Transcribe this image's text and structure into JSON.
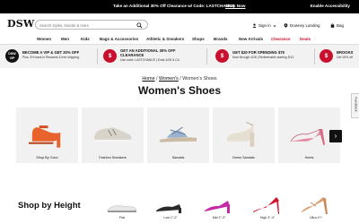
{
  "promo_bar": {
    "text": "Take an Additional 30% Off Clearance w/ Code: LASTCHANCE",
    "link": "Shop Now",
    "accessibility": "Enable Accessibility"
  },
  "header": {
    "logo": "DSW",
    "search_placeholder": "Search styles, brands & more",
    "signin": "Sign in",
    "store": "Downey Landing",
    "bag": "Bag"
  },
  "nav": {
    "items": [
      "Women",
      "Men",
      "Kids",
      "Bags & Accessories",
      "Athletic & Sneakers",
      "Shops",
      "Brands",
      "New Arrivals",
      "Clearance",
      "Deals"
    ]
  },
  "promos": [
    {
      "badge": "DSW VIP",
      "title": "BECOME A VIP & GET 20% OFF",
      "sub": "Plus, 5% back in Rewards & free shipping."
    },
    {
      "badge": "$",
      "title": "GET AN ADDITIONAL 30% OFF CLEARANCE",
      "sub": "Use code: LASTCHANCE | Ends 4/28 & CA"
    },
    {
      "badge": "$",
      "title": "GET $20 FOR SPENDING $75",
      "sub": "Now through 4/28 | Redeemable starting 5/12"
    },
    {
      "badge": "$",
      "title": "BROOKS",
      "sub": "Get 15% off"
    }
  ],
  "breadcrumb": {
    "home": "Home",
    "sep": "/",
    "women": "Women's",
    "current": "Women's Shoes"
  },
  "page_title": "Women's Shoes",
  "categories": [
    {
      "label": "Shop By Color",
      "color": "#e8622c"
    },
    {
      "label": "Fashion Sneakers",
      "color": "#d8d4cc"
    },
    {
      "label": "Sandals",
      "color": "#9cb3cf"
    },
    {
      "label": "Dress Sandals",
      "color": "#e6e0d2"
    },
    {
      "label": "Heels",
      "color": "#e58aa3"
    }
  ],
  "next_arrow": "›",
  "feedback": "Feedback",
  "shop_by_height": {
    "title": "Shop by Height",
    "items": [
      {
        "label": "Flat",
        "color": "#e7e7e7"
      },
      {
        "label": "Low 1\"-2\"",
        "color": "#2a2a2a"
      },
      {
        "label": "Mid 2\"-3\"",
        "color": "#c72aa5"
      },
      {
        "label": "High 3\"-4\"",
        "color": "#d2122e"
      },
      {
        "label": "Ultra 4\"+",
        "color": "#d9a070"
      }
    ]
  },
  "colors": {
    "brand_red": "#c8102e",
    "black": "#000000"
  }
}
